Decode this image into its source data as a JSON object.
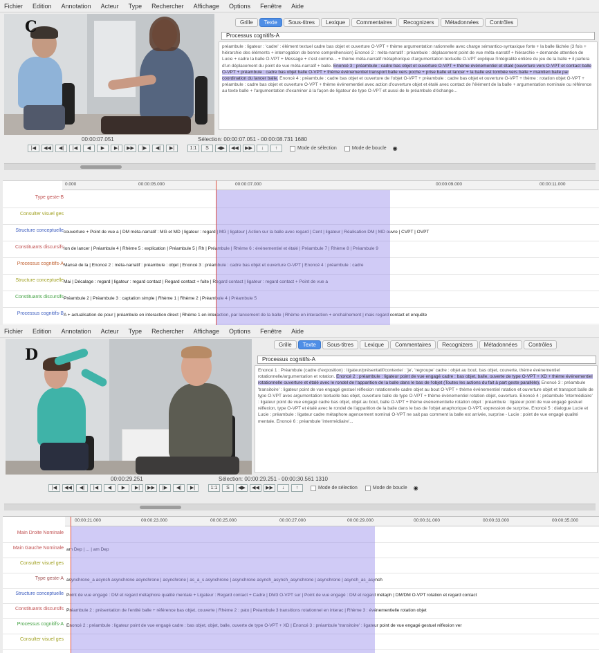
{
  "menu": [
    "Fichier",
    "Edition",
    "Annotation",
    "Acteur",
    "Type",
    "Rechercher",
    "Affichage",
    "Options",
    "Fenêtre",
    "Aide"
  ],
  "tabs": [
    "Grille",
    "Texte",
    "Sous-titres",
    "Lexique",
    "Commentaires",
    "Recognizers",
    "Métadonnées",
    "Contrôles"
  ],
  "active_tab": "Texte",
  "checkbox_labels": [
    "Mode de sélection",
    "Mode de boucle"
  ],
  "controls": [
    "|◀",
    "◀◀",
    "◀|",
    "|◀",
    "◀",
    "▶",
    "▶|",
    "▶▶",
    "|▶",
    "◀|",
    "▶|"
  ],
  "controls_small": [
    "1:1",
    "S",
    "◀▶",
    "◀◀",
    "▶▶",
    "↓",
    "↑"
  ],
  "panel_c": {
    "letter": "C",
    "video_time": "00:00:07.051",
    "selection": "Sélection: 00:00:07.051 - 00:00:08.731  1680",
    "process_label": "Processus cognitifs-A",
    "ruler_ticks": [
      "0.000",
      "00:00:05.000",
      "00:00:07.000",
      "00:00:09.000",
      "00:00:11.000"
    ],
    "tier_labels": [
      "Type geste-B",
      "Consulter visuel ges",
      "Structure conceptuelle",
      "Constituants discursifs",
      "Processus cognitifs-A",
      "Structure conceptuelle",
      "Constituants discursifs",
      "Processus cognitifs-B"
    ],
    "tier_colors": [
      "#c05050",
      "#a0a020",
      "#4060c0",
      "#c05050",
      "#c06030",
      "#a0a020",
      "#40a040",
      "#4060c0"
    ],
    "tier_texts": [
      "",
      "",
      "couverture + Point de vue a | DM méta-narratif : MG et MD | ligateur : regard | MG | ligateur | Action sur la balle avec regard | Cent | ligateur | Réalisation DM | MD ouvre | CVPT | OVPT",
      "Ion de lancer | Préambule 4 | Rhème 5 : explication | Préambule 5 | Rh | Préambule | Rhème 6 : événementiel et étalé | Préambule 7 | Rhème 8 | Préambule 9",
      "Mansé de la | Enoncé 2 : méta-narratif : préambule : objet | Enoncé 3 : préambule : cadre bas objet et ouverture O-VPT | Enoncé 4 : préambule : cadre",
      "Mai | Décalage : regard | ligateur : regard contact | Regard contact + fuite | Regard contact | ligateur : regard contact + Point de vue a",
      "Préambule 2 | Préambule 3 : captation simple | Rhème 1 | Rhème 2 | Préambule 4 | Préambule 5",
      "A + actualisation de pour | préambule en interaction direct | Rhème 1 en interaction, par lancement de la balle | Rhème en interaction + enchaînement | mais regard contact et enquête"
    ],
    "text_before": "préambule : ligateur : 'cadre' : élément textuel cadre bas objet et ouverture O-VPT + thème argumentation rationnelle avec charge sémantico-syntaxique forte + la balle lâchée (3 fois + hiérarchie des éléments + interrogation de bonne compréhension) Enoncé 2 : méta-narratif : préambule : déplacement point de vue méta-narratif + hiérarchie + demande attention de Lucie + cadre la balle O-VPT + Message + c'est comme... + thème méta-narratif métaphorique d'argumentation textuelle O-VPT explique l'intégralité entière du jeu de la balle + il parlera d'un déplacement du point de vue méta-narratif + balle.",
    "text_highlight": "Enoncé 3 : préambule : cadre bas objet et ouverture O-VPT + thème événementiel et étalé (ouverture vers O-VPT et contact balle O-VPT + préambule : cadre bas objet balle O-VPT + thème événementiel transport balle vers poche + prise balle et lancer + la balle est tombée vers balle + maintien balle par coordination du lancer balle.",
    "text_after": "Enoncé 4 : préambule : cadre bas objet et ouverture de l'objet O-VPT + préambule : cadre bas objet et ouverture O-VPT + thème : rotation objet O-VPT + préambule : cadre bas objet et ouverture O-VPT + thème événementiel avec action d'ouverture objet et étalé avec contact de l'élément de la balle + argumentation nominale ou référence au texte balle + l'argumentation d'examiner à la façon de ligateur de type O-VPT et aussi de le préambule d'échange..."
  },
  "panel_d": {
    "letter": "D",
    "video_time": "00:00:29.251",
    "selection": "Sélection: 00:00:29.251 - 00:00:30.561  1310",
    "process_label": "Processus cognitifs-A",
    "ruler_ticks": [
      "00:00:21.000",
      "00:00:23.000",
      "00:00:25.000",
      "00:00:27.000",
      "00:00:29.000",
      "00:00:31.000",
      "00:00:33.000",
      "00:00:35.000"
    ],
    "tier_labels": [
      "Main Droite Nominale",
      "Main Gauche Nominale",
      "Consulter visuel ges",
      "Type geste-A",
      "Structure conceptuelle",
      "Constituants discursifs",
      "Processus cognitifs-A",
      "Consulter visuel ges"
    ],
    "tier_colors": [
      "#c05050",
      "#c05050",
      "#a0a020",
      "#a05050",
      "#4060c0",
      "#c05050",
      "#40a040",
      "#a0a020"
    ],
    "tier_texts": [
      "",
      "am Dep | ... | am Dep",
      "",
      "asynchrone_a  asynch  asynchrone  asynchrone  |  asynchrone  |  as_a_s  asynchrone  |  asynchrone  asynch_asynch_asynchrone  |  asynchrone  |  asynch_as_asynch",
      "Point de vue engagé : DM et regard métaphore qualité mentale + Ligateur : Regard contact + Cadre | DM3 O-VPT sur | Point de vue engagé : DM et regard métaph | DM/DM O-VPT rotation et regard contact",
      "Préambule 2 : présentation de l'entité balle + référence bas objet, couverte | Rhème 2 : pato | Préambule 3 transitions rotationnel en interac | Rhème 3 : événementielle rotation objet",
      "Enoncé 2 : préambule : ligateur point de vue engagé cadre : bas objet, objet, balle, ouverte de type O-VPT + XD | Enoncé 3 : préambule 'transitoire' : ligateur point de vue engagé gestuel réflexion ver",
      ""
    ],
    "text_before": "Enoncé 1 : Préambule (cadre d'exposition) : ligateur/présentatif/contexte/ : 'je', 'regroupe' cadre : objet au bout, bas objet, couverte, thème événementiel rotationnelle/argumentation et rotation.",
    "text_highlight": "Enoncé 2 : préambule : ligateur point de vue engagé cadre : bas objet, balle, ouverte de type O-VPT + XD + thème événementiel rotationnelle ouverture et étalé avec le rondel de l'apparition de la balle dans le bas de l'objet (Toutes les actions du fait à part geste parallèle).",
    "text_after": "Enoncé 3 : préambule 'transitoire' : ligateur point de vue engagé gestuel réflexion rotationnelle cadre objet au bout O-VPT + thème événementiel rotation et ouverture objet et transport balle de type O-VPT avec argumentation textuelle bas objet, ouverture balle de type O-VPT + thème événementiel rotation objet, ouverture. Enoncé 4 : préambule 'intermédiaire' : ligateur point de vue engagé cadre bas objet, objet au bout, balle O-VPT + thème événementielle rotation objet : préambule : ligateur point de vue engagé gestuel réflexion, type O-VPT et étalé avec le rondel de l'apparition de la balle dans le bas de l'objet anaphorique O-VPT, expression de surprise. Enoncé 5 : dialogue Lucie et Lucie : préambule : ligateur cadre métaphore agencement nominal O-VPT ne sait pas comment la balle est arrivée, surprise - Lucie : point de vue engagé qualité mentale. Enoncé 6 : préambule 'intermédiaire'..."
  }
}
